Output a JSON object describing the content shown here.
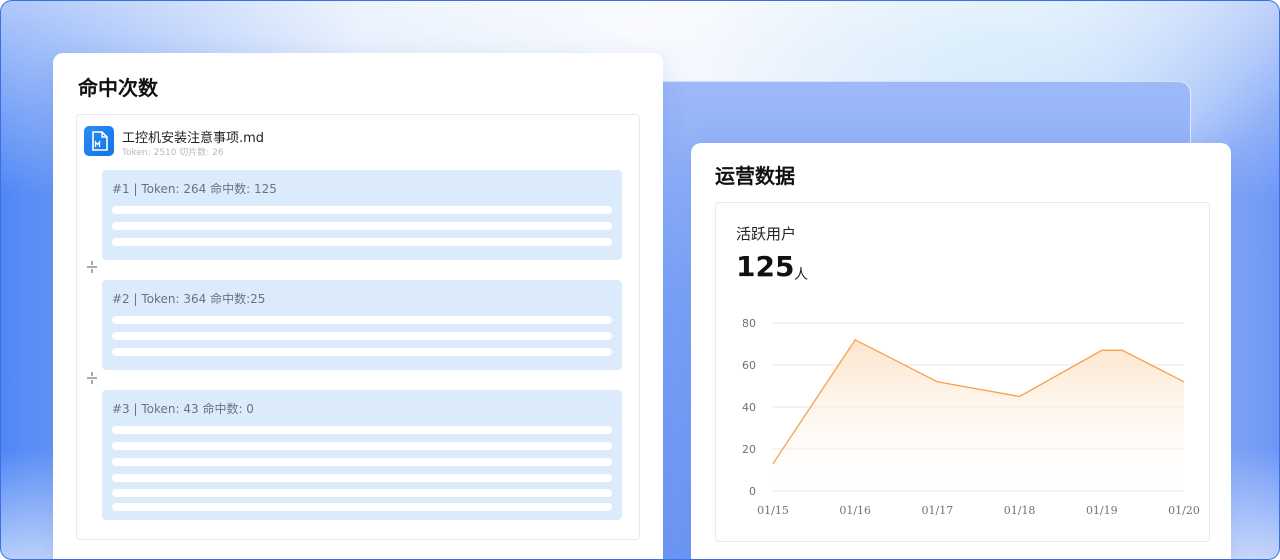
{
  "hits_card": {
    "title": "命中次数",
    "file": {
      "name": "工控机安装注意事项.md",
      "meta": "Token: 2510 切片数: 26",
      "icon": "markdown-file-icon"
    },
    "chunks": [
      {
        "label": "#1 | Token: 264 命中数: 125",
        "lines": 3
      },
      {
        "label": "#2 | Token: 364 命中数:25",
        "lines": 3
      },
      {
        "label": "#3 | Token: 43 命中数: 0",
        "lines": 6
      }
    ],
    "divider_icon": "split-icon"
  },
  "ops_card": {
    "title": "运营数据",
    "metric": {
      "label": "活跃用户",
      "value": "125",
      "unit": "人"
    }
  },
  "chart_data": {
    "type": "area",
    "categories": [
      "01/15",
      "01/16",
      "01/17",
      "01/18",
      "01/19",
      "01/20"
    ],
    "x": [
      "01/15",
      "",
      "01/16",
      "",
      "01/17",
      "",
      "01/18",
      "",
      "01/19",
      "",
      "01/20"
    ],
    "values": [
      13,
      72,
      "",
      52,
      "",
      45,
      "",
      67,
      "",
      67,
      52
    ],
    "series": [
      {
        "points": [
          [
            0,
            13
          ],
          [
            1,
            72
          ],
          [
            2,
            52
          ],
          [
            3,
            45
          ],
          [
            4,
            67
          ],
          [
            5,
            67
          ],
          [
            6,
            52
          ]
        ]
      }
    ],
    "point_x_categories_fraction": [
      0,
      0.2,
      0.4,
      0.6,
      0.8,
      0.85,
      1.0
    ],
    "yticks": [
      "0",
      "20",
      "40",
      "60",
      "80"
    ],
    "ylim": [
      0,
      80
    ],
    "grid": true,
    "colors": {
      "line": "#f5a04a",
      "fill_top": "#fde3c8",
      "grid": "#e5e7eb",
      "axis_text": "#6b7280"
    }
  }
}
